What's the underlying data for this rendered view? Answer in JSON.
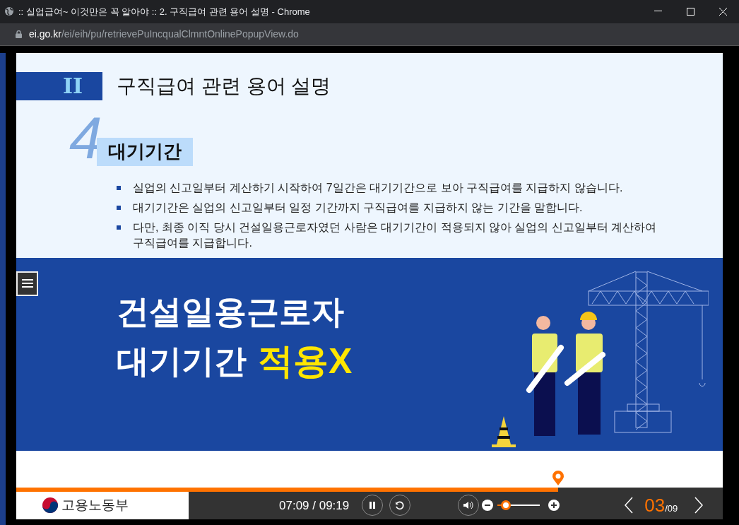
{
  "window": {
    "title": ":: 실업급여~ 이것만은 꼭 알아야 :: 2. 구직급여 관련 용어 설명 - Chrome"
  },
  "address_bar": {
    "host": "ei.go.kr",
    "path": "/ei/eih/pu/retrievePuIncqualClmntOnlinePopupView.do"
  },
  "slide": {
    "section_numeral": "II",
    "section_title": "구직급여 관련 용어 설명",
    "term_number": "4",
    "term": "대기기간",
    "bullets": [
      "실업의 신고일부터 계산하기 시작하여 7일간은 대기기간으로 보아 구직급여를 지급하지 않습니다.",
      "대기기간은 실업의 신고일부터 일정 기간까지 구직급여를 지급하지 않는 기간을 말합니다.",
      "다만, 최종 이직 당시 건설일용근로자였던 사람은 대기기간이 적용되지 않아 실업의 신고일부터 계산하여 구직급여를 지급합니다."
    ],
    "banner": {
      "line_1": "건설일용근로자",
      "line_2": "대기기간",
      "highlight": "적용X"
    }
  },
  "player": {
    "progress": {
      "level": 0.767
    },
    "logo_text": "고용노동부",
    "time": "07:09 / 09:19",
    "volume": {
      "level": 0.2
    },
    "current_page": "03",
    "total_pages": "/09"
  }
}
